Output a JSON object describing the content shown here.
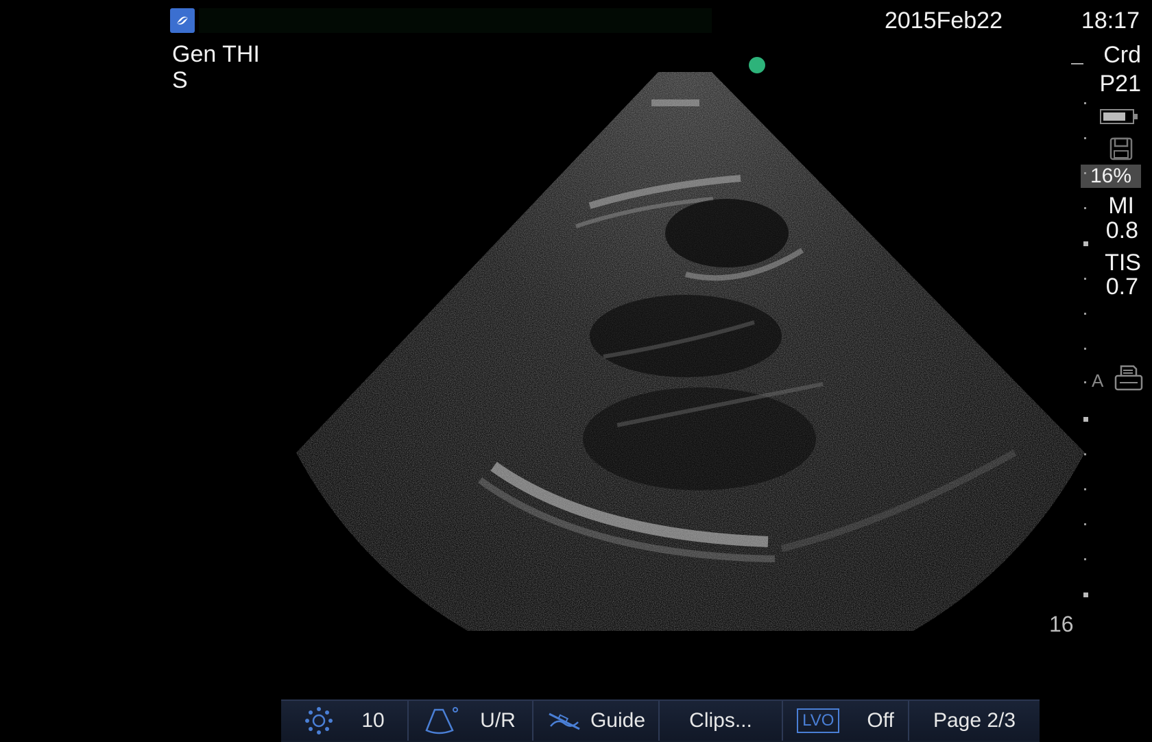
{
  "header": {
    "logo_icon": "sonosite-logo-icon",
    "mode_line1": "Gen  THI",
    "mode_line2": "S",
    "date": "2015Feb22",
    "time": "18:17"
  },
  "right_panel": {
    "exam_type": "Crd",
    "transducer": "P21",
    "battery_icon": "battery-icon",
    "storage_icon": "floppy-disk-icon",
    "storage_percent": "16%",
    "mi_label": "MI",
    "mi_value": "0.8",
    "tis_label": "TIS",
    "tis_value": "0.7",
    "annotation_marker": "A",
    "print_icon": "printer-icon",
    "depth_value": "16"
  },
  "toolbar": {
    "brightness_value": "10",
    "orientation_label": "U/R",
    "guide_label": "Guide",
    "clips_label": "Clips...",
    "lvo_badge": "LVO",
    "lvo_state": "Off",
    "page_label": "Page 2/3"
  },
  "colors": {
    "orientation_marker": "#2db37a",
    "toolbar_bg": "#151d2c",
    "accent_blue": "#4a7fd6"
  }
}
